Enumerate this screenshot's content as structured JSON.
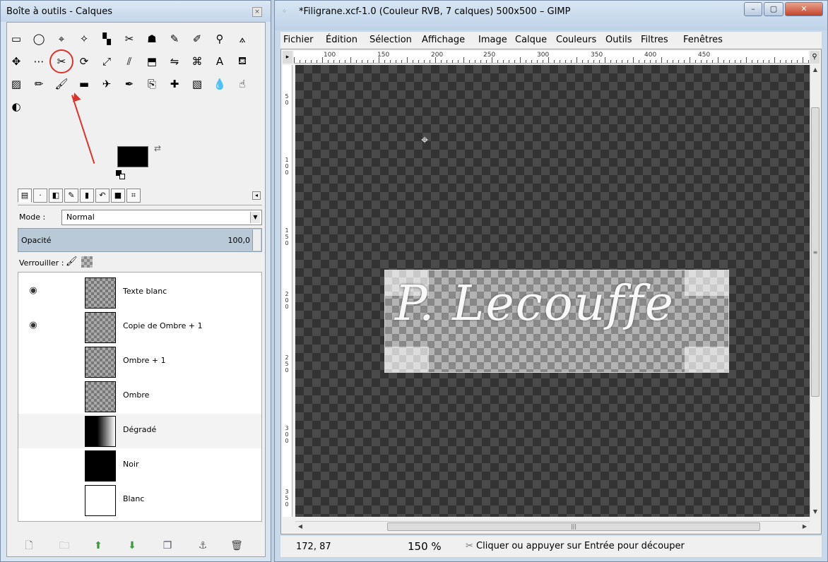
{
  "toolbox": {
    "title": "Boîte à outils - Calques",
    "close_icon": "×",
    "tools": [
      {
        "name": "rect-select-icon",
        "glyph": "▭"
      },
      {
        "name": "ellipse-select-icon",
        "glyph": "◯"
      },
      {
        "name": "free-select-icon",
        "glyph": "⌖"
      },
      {
        "name": "fuzzy-select-icon",
        "glyph": "✧"
      },
      {
        "name": "color-select-icon",
        "glyph": "▚"
      },
      {
        "name": "scissors-select-icon",
        "glyph": "✂"
      },
      {
        "name": "foreground-select-icon",
        "glyph": "☗"
      },
      {
        "name": "paths-icon",
        "glyph": "✎"
      },
      {
        "name": "color-picker-icon",
        "glyph": "✐"
      },
      {
        "name": "zoom-icon",
        "glyph": "⚲"
      },
      {
        "name": "measure-icon",
        "glyph": "⟑"
      },
      {
        "name": "move-icon",
        "glyph": "✥"
      },
      {
        "name": "align-icon",
        "glyph": "⋯"
      },
      {
        "name": "crop-icon",
        "glyph": "✂"
      },
      {
        "name": "rotate-icon",
        "glyph": "⟳"
      },
      {
        "name": "scale-icon",
        "glyph": "⤢"
      },
      {
        "name": "shear-icon",
        "glyph": "⫽"
      },
      {
        "name": "perspective-icon",
        "glyph": "⬒"
      },
      {
        "name": "flip-icon",
        "glyph": "⇋"
      },
      {
        "name": "cage-icon",
        "glyph": "⌘"
      },
      {
        "name": "text-icon",
        "glyph": "A"
      },
      {
        "name": "bucket-fill-icon",
        "glyph": "⛾"
      },
      {
        "name": "blend-icon",
        "glyph": "▨"
      },
      {
        "name": "pencil-icon",
        "glyph": "✏"
      },
      {
        "name": "paintbrush-icon",
        "glyph": "🖌"
      },
      {
        "name": "eraser-icon",
        "glyph": "▬"
      },
      {
        "name": "airbrush-icon",
        "glyph": "✈"
      },
      {
        "name": "ink-icon",
        "glyph": "✒"
      },
      {
        "name": "clone-icon",
        "glyph": "⎘"
      },
      {
        "name": "heal-icon",
        "glyph": "✚"
      },
      {
        "name": "perspective-clone-icon",
        "glyph": "▧"
      },
      {
        "name": "blur-icon",
        "glyph": "💧"
      },
      {
        "name": "smudge-icon",
        "glyph": "☝"
      },
      {
        "name": "dodge-burn-icon",
        "glyph": "◐"
      }
    ],
    "selected_tool": "crop-icon",
    "dock_tabs": [
      "layers-tab",
      "channels-tab",
      "paths-tab",
      "colormap-tab",
      "histogram-tab",
      "undo-tab",
      "colors-tab",
      "pointer-tab"
    ],
    "mode": {
      "label": "Mode :",
      "value": "Normal"
    },
    "opacity": {
      "label": "Opacité",
      "value": "100,0"
    },
    "lock": {
      "label": "Verrouiller :"
    },
    "layers": [
      {
        "name": "Texte blanc",
        "visible": true,
        "thumb": "chk",
        "highlight": false
      },
      {
        "name": "Copie de Ombre + 1",
        "visible": true,
        "thumb": "chk",
        "highlight": false
      },
      {
        "name": "Ombre + 1",
        "visible": false,
        "thumb": "chk",
        "highlight": false
      },
      {
        "name": "Ombre",
        "visible": false,
        "thumb": "chk",
        "highlight": false
      },
      {
        "name": "Dégradé",
        "visible": false,
        "thumb": "grad",
        "highlight": true
      },
      {
        "name": "Noir",
        "visible": false,
        "thumb": "black",
        "highlight": false
      },
      {
        "name": "Blanc",
        "visible": false,
        "thumb": "white",
        "highlight": false
      }
    ],
    "layer_buttons": [
      {
        "name": "new-layer-icon",
        "glyph": "🗋"
      },
      {
        "name": "new-group-icon",
        "glyph": "🗀"
      },
      {
        "name": "raise-layer-icon",
        "glyph": "⬆"
      },
      {
        "name": "lower-layer-icon",
        "glyph": "⬇"
      },
      {
        "name": "duplicate-layer-icon",
        "glyph": "❐"
      },
      {
        "name": "anchor-layer-icon",
        "glyph": "⚓"
      },
      {
        "name": "delete-layer-icon",
        "glyph": "🗑"
      }
    ]
  },
  "image_window": {
    "title": "*Filigrane.xcf-1.0 (Couleur RVB, 7 calques) 500x500 – GIMP",
    "menu": [
      "Fichier",
      "Édition",
      "Sélection",
      "Affichage",
      "Image",
      "Calque",
      "Couleurs",
      "Outils",
      "Filtres",
      "Fenêtres"
    ],
    "ruler_h_labels": [
      "100",
      "150",
      "200",
      "250",
      "300",
      "350",
      "400",
      "450"
    ],
    "ruler_v_labels": [
      "50",
      "100",
      "150",
      "200",
      "250",
      "300",
      "350"
    ],
    "watermark_text": "P. Lecouffe",
    "status": {
      "coords": "172, 87",
      "zoom": "150 %",
      "message": "Cliquer ou appuyer sur Entrée pour découper"
    }
  },
  "colors": {
    "accent_red": "#d9342b",
    "fg": "#000000",
    "bg": "#ffffff"
  }
}
